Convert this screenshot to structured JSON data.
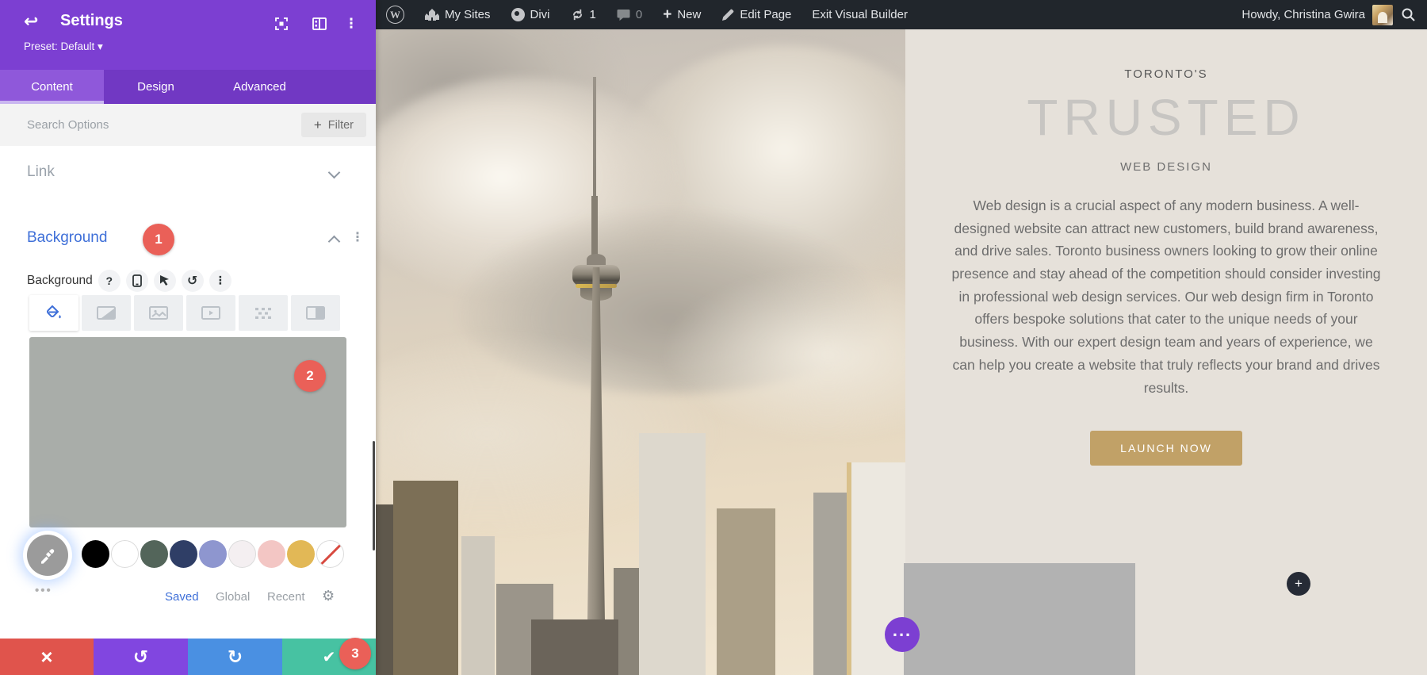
{
  "admin_bar": {
    "my_sites": "My Sites",
    "divi": "Divi",
    "updates_count": "1",
    "comments_count": "0",
    "new_label": "New",
    "edit_page": "Edit Page",
    "exit_builder": "Exit Visual Builder",
    "howdy": "Howdy, Christina Gwira"
  },
  "panel": {
    "title": "Settings",
    "preset": "Preset: Default ▾",
    "tabs": {
      "content": "Content",
      "design": "Design",
      "advanced": "Advanced"
    },
    "search_placeholder": "Search Options",
    "filter_label": "Filter",
    "link_section_title": "Link",
    "background_section_title": "Background",
    "background_field_label": "Background",
    "help_glyph": "?",
    "badges": {
      "step1": "1",
      "step2": "2",
      "step3": "3"
    },
    "swatch_links": {
      "saved": "Saved",
      "global": "Global",
      "recent": "Recent"
    },
    "swatches": [
      {
        "color": "#000000"
      },
      {
        "color": "#ffffff",
        "bordered": true
      },
      {
        "color": "#53655a"
      },
      {
        "color": "#2f3e66"
      },
      {
        "color": "#8e96cf"
      },
      {
        "color": "#f4eff1",
        "bordered": true
      },
      {
        "color": "#f3c6c4"
      },
      {
        "color": "#e2b856"
      },
      {
        "color": "#ffffff",
        "bordered": true,
        "slash": true
      }
    ]
  },
  "icons": {
    "back": "↩",
    "kebab": "⋮",
    "undo": "↺",
    "redo": "↻",
    "check": "✔",
    "close": "×",
    "gear": "⚙",
    "plus": "+",
    "more": "•••",
    "ellipsis": "..."
  },
  "page": {
    "kicker": "TORONTO'S",
    "heading": "TRUSTED",
    "subheading": "WEB DESIGN",
    "paragraph": "Web design is a crucial aspect of any modern business. A well-designed website can attract new customers, build brand awareness, and drive sales. Toronto business owners looking to grow their online presence and stay ahead of the competition should consider investing in professional web design services. Our web design firm in Toronto offers bespoke solutions that cater to the unique needs of your business. With our expert design team and years of experience, we can help you create a website that truly reflects your brand and drives results.",
    "cta": "LAUNCH NOW"
  },
  "colors": {
    "divi_purple": "#7c3fd2",
    "active_tab_purple": "#8f58da",
    "link_blue": "#3e6fd8",
    "badge_red": "#ea6058",
    "cta_tan": "#c1a167",
    "save_teal": "#47c2a2",
    "redo_blue": "#4a90e2",
    "discard_red": "#e0544c",
    "admin_bar_bg": "#21262c"
  }
}
